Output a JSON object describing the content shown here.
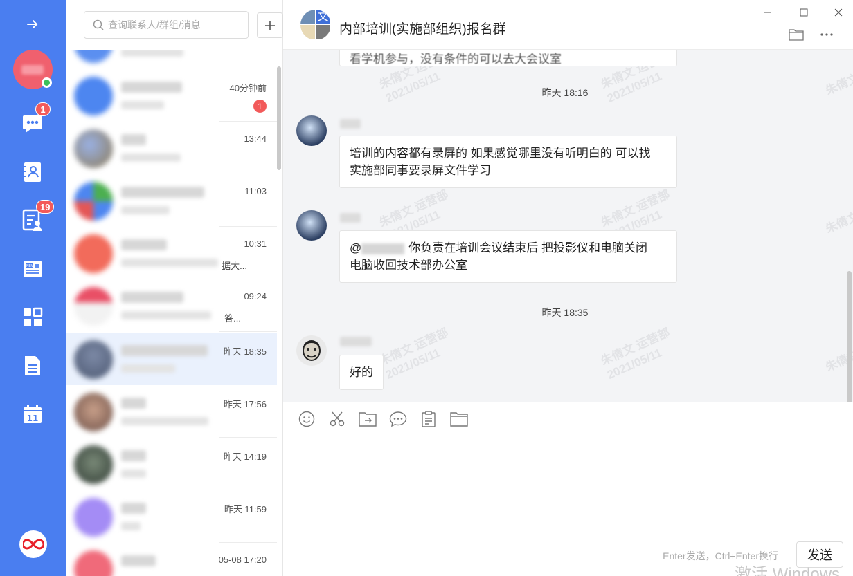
{
  "nav": {
    "chat_badge": "1",
    "tasks_badge": "19",
    "calendar_day": "11",
    "items": [
      "expand-arrow-icon",
      "chat-bubble-icon",
      "contacts-icon",
      "approval-icon",
      "news-icon",
      "apps-grid-icon",
      "document-icon",
      "calendar-icon",
      "loop-logo-icon"
    ]
  },
  "search": {
    "placeholder": "查询联系人/群组/消息"
  },
  "conversations": [
    {
      "time": "40分钟前",
      "unread": "1",
      "snippet": ""
    },
    {
      "time": "13:44",
      "unread": "",
      "snippet": ""
    },
    {
      "time": "11:03",
      "unread": "",
      "snippet": ""
    },
    {
      "time": "10:31",
      "unread": "",
      "snippet": "据大..."
    },
    {
      "time": "09:24",
      "unread": "",
      "snippet": "答..."
    },
    {
      "time": "昨天 18:35",
      "unread": "",
      "snippet": ""
    },
    {
      "time": "昨天 17:56",
      "unread": "",
      "snippet": ""
    },
    {
      "time": "昨天 14:19",
      "unread": "",
      "snippet": ""
    },
    {
      "time": "昨天 11:59",
      "unread": "",
      "snippet": ""
    },
    {
      "time": "05-08 17:20",
      "unread": "",
      "snippet": ""
    }
  ],
  "chat": {
    "title": "内部培训(实施部组织)报名群",
    "group_avatar_char": "文",
    "partial_top_message": "看学机参与，没有条件的可以去大会议室",
    "timestamps": [
      "昨天 18:16",
      "昨天 18:35"
    ],
    "messages": [
      {
        "text_line1": "培训的内容都有录屏的  如果感觉哪里没有听明白的 可以找",
        "text_line2": "实施部同事要录屏文件学习"
      },
      {
        "mention": "@",
        "text_line1": "你负责在培训会议结束后  把投影仪和电脑关闭",
        "text_line2": " 电脑收回技术部办公室"
      },
      {
        "text_line1": "好的"
      }
    ],
    "watermark_name": "朱倩文 运营部",
    "watermark_date": "2021/05/11"
  },
  "composer": {
    "hint": "Enter发送，Ctrl+Enter换行",
    "send_label": "发送",
    "activation_text": "激活 Windows"
  },
  "colors": {
    "nav_bg": "#4a7ef0",
    "badge": "#f25a5a",
    "active_row": "#eaf1fd"
  }
}
